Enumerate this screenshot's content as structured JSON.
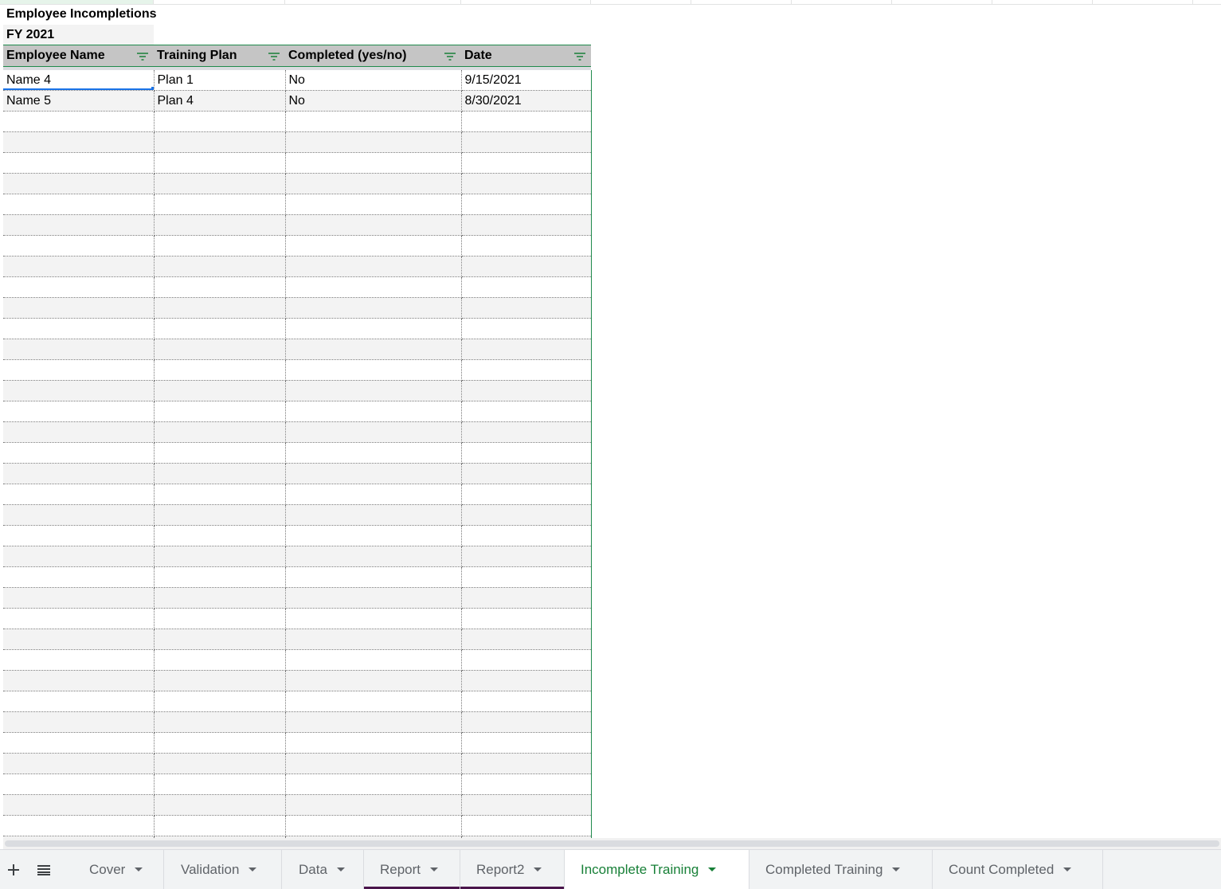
{
  "sheet": {
    "title": "Employee Incompletions",
    "subtitle": "FY 2021",
    "headers": [
      "Employee Name",
      "Training Plan",
      "Completed (yes/no)",
      "Date"
    ],
    "rows": [
      [
        "Name 4",
        "Plan 1",
        "No",
        "9/15/2021"
      ],
      [
        "Name 5",
        "Plan 4",
        "No",
        "8/30/2021"
      ]
    ],
    "empty_rows": 36
  },
  "toolbar": {
    "add_sheet_icon": "plus-icon",
    "all_sheets_icon": "list-icon"
  },
  "tabs": [
    {
      "label": "Cover",
      "active": false,
      "underline": ""
    },
    {
      "label": "Validation",
      "active": false,
      "underline": ""
    },
    {
      "label": "Data",
      "active": false,
      "underline": ""
    },
    {
      "label": "Report",
      "active": false,
      "underline": "#4a154b"
    },
    {
      "label": "Report2",
      "active": false,
      "underline": "#4a154b"
    },
    {
      "label": "Incomplete Training",
      "active": true,
      "underline": ""
    },
    {
      "label": "Completed Training",
      "active": false,
      "underline": ""
    },
    {
      "label": "Count Completed",
      "active": false,
      "underline": ""
    }
  ],
  "colors": {
    "header_bg": "#c5c5c5",
    "band_bg": "#f3f3f3",
    "active_tab": "#188038",
    "selection": "#1a73e8"
  }
}
